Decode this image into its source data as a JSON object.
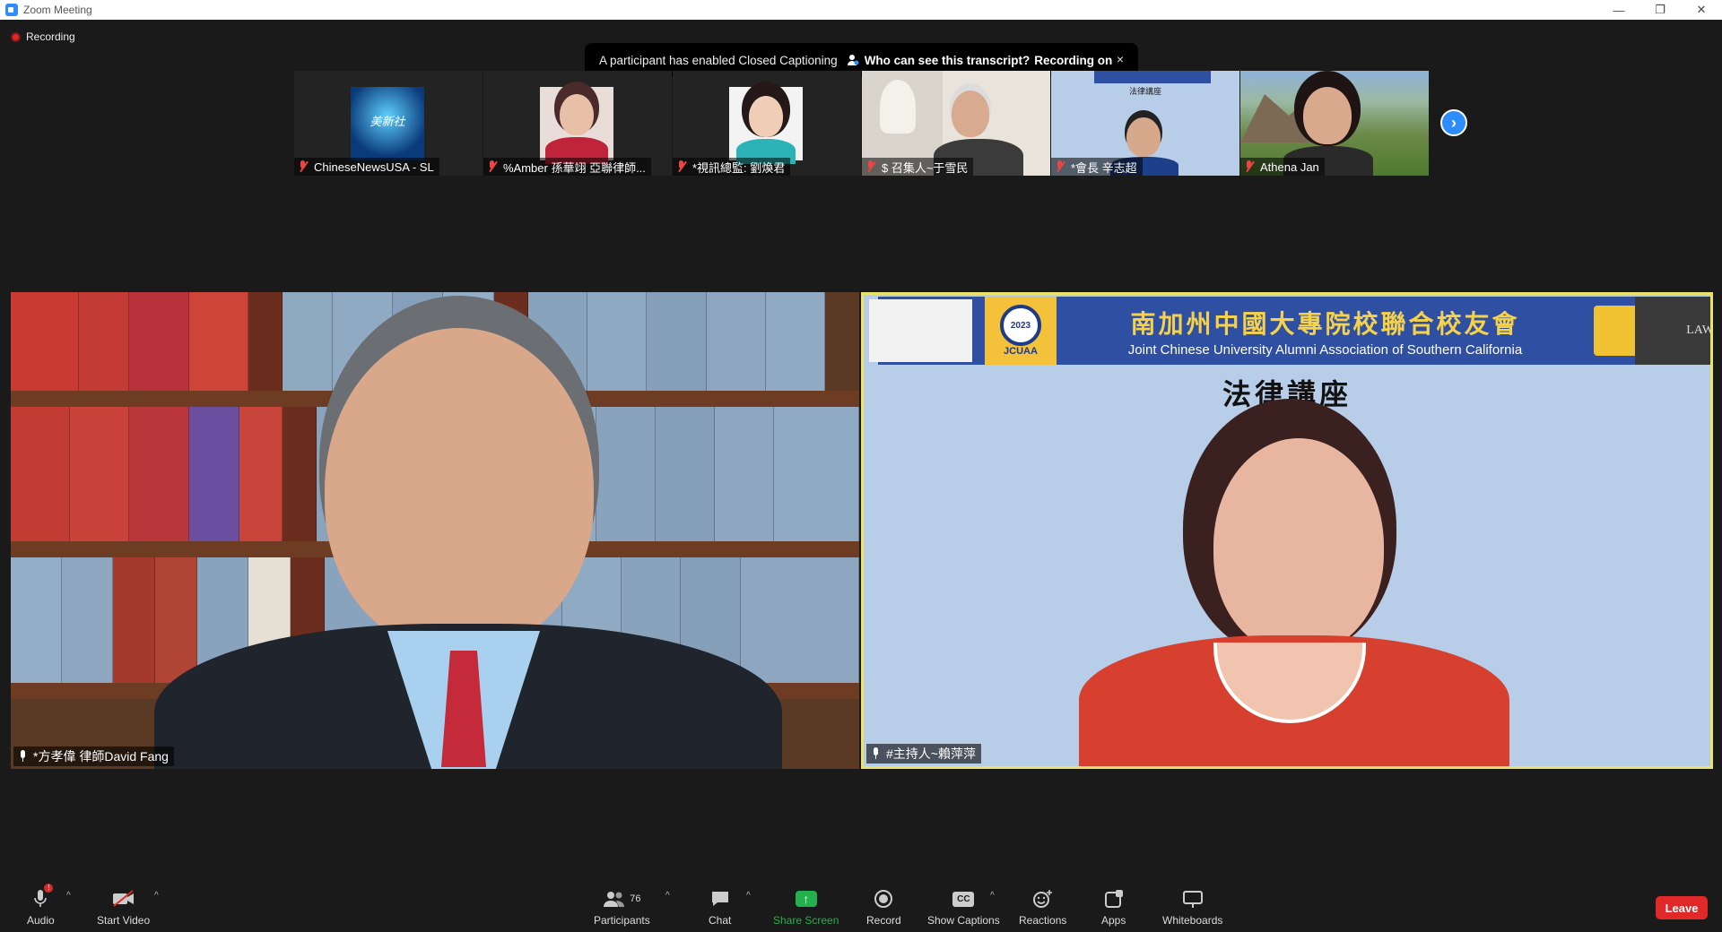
{
  "window": {
    "title": "Zoom Meeting",
    "minimize": "—",
    "restore": "❐",
    "close": "✕"
  },
  "recording": {
    "label": "Recording"
  },
  "caption_notice": {
    "message": "A participant has enabled Closed Captioning",
    "question": "Who can see this transcript?",
    "status": "Recording on",
    "close": "×"
  },
  "thumbnails": [
    {
      "name": "ChineseNewsUSA - SL"
    },
    {
      "name": "%Amber 孫華翊 亞聯律師..."
    },
    {
      "name": "*視訊總監: 劉煥君"
    },
    {
      "name": "$ 召集人~于雪民"
    },
    {
      "name": "*會長 辛志超"
    },
    {
      "name": "Athena Jan"
    }
  ],
  "thumb_extra": {
    "mini_banner_title": "法律講座",
    "news_logo": "美新社"
  },
  "main_left": {
    "name": "*方孝偉 律師David Fang"
  },
  "main_right": {
    "name": "#主持人~賴萍萍",
    "banner_cn": "南加州中國大專院校聯合校友會",
    "banner_en": "Joint Chinese University Alumni Association of Southern California",
    "seal_year": "2023",
    "seal_abbr": "JCUAA",
    "law_label": "LAW",
    "lecture_title": "法律講座"
  },
  "toolbar": {
    "audio": "Audio",
    "start_video": "Start Video",
    "participants": "Participants",
    "participants_count": "76",
    "chat": "Chat",
    "share_screen": "Share Screen",
    "record": "Record",
    "show_captions": "Show Captions",
    "reactions": "Reactions",
    "apps": "Apps",
    "whiteboards": "Whiteboards",
    "leave": "Leave",
    "audio_badge": "!",
    "cc_text": "CC",
    "caret": "^"
  },
  "colors": {
    "accent": "#2d8cff",
    "leave": "#e02828",
    "share": "#22b14c",
    "speaker_border": "#e9e36b"
  }
}
